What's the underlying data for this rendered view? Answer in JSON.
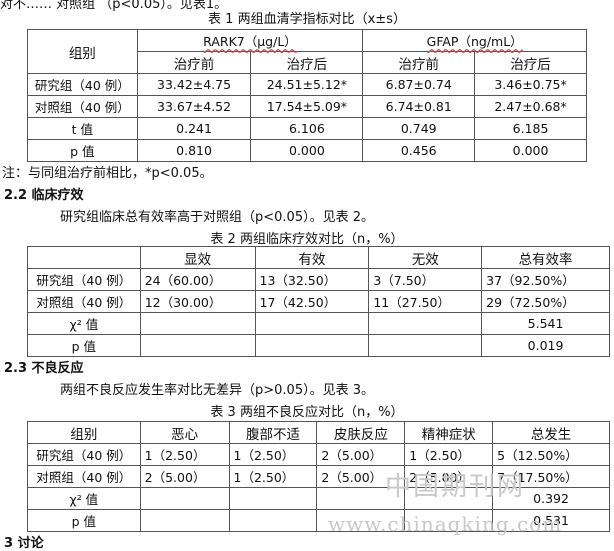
{
  "top_fragment": "对不…… 对照组 （p<0.05）。见表1。",
  "table1": {
    "caption": "表 1 两组血清学指标对比（x±s）",
    "group_header": "组别",
    "col_rark7": "RARK7（μg/L）",
    "col_gfap": "GFAP（ng/mL）",
    "sub_before": "治疗前",
    "sub_after": "治疗后",
    "rows": [
      {
        "label": "研究组（40 例）",
        "a": "33.42±4.75",
        "b": "24.51±5.12*",
        "c": "6.87±0.74",
        "d": "3.46±0.75*"
      },
      {
        "label": "对照组（40 例）",
        "a": "33.67±4.52",
        "b": "17.54±5.09*",
        "c": "6.74±0.81",
        "d": "2.47±0.68*"
      },
      {
        "label": "t 值",
        "a": "0.241",
        "b": "6.106",
        "c": "0.749",
        "d": "6.185"
      },
      {
        "label": "p 值",
        "a": "0.810",
        "b": "0.000",
        "c": "0.456",
        "d": "0.000"
      }
    ],
    "note": "注：与同组治疗前相比，*p<0.05。"
  },
  "section22": {
    "heading": "2.2 临床疗效",
    "body": "研究组临床总有效率高于对照组（p<0.05）。见表 2。"
  },
  "table2": {
    "caption": "表 2 两组临床疗效对比（n，%）",
    "headers": [
      "",
      "显效",
      "有效",
      "无效",
      "总有效率"
    ],
    "rows": [
      {
        "label": "研究组（40 例）",
        "c1": "24（60.00）",
        "c2": "13（32.50）",
        "c3": "3（7.50）",
        "c4": "37（92.50%）"
      },
      {
        "label": "对照组（40 例）",
        "c1": "12（30.00）",
        "c2": "17（42.50）",
        "c3": "11（27.50）",
        "c4": "29（72.50%）"
      },
      {
        "label": "χ² 值",
        "c1": "",
        "c2": "",
        "c3": "",
        "c4": "5.541"
      },
      {
        "label": "p 值",
        "c1": "",
        "c2": "",
        "c3": "",
        "c4": "0.019"
      }
    ]
  },
  "section23": {
    "heading": "2.3 不良反应",
    "body": "两组不良反应发生率对比无差异（p>0.05）。见表 3。"
  },
  "table3": {
    "caption": "表 3 两组不良反应对比（n，%）",
    "headers": [
      "组别",
      "恶心",
      "腹部不适",
      "皮肤反应",
      "精神症状",
      "总发生"
    ],
    "rows": [
      {
        "label": "研究组（40 例）",
        "c1": "1（2.50）",
        "c2": "1（2.50）",
        "c3": "2（5.00）",
        "c4": "1（2.50）",
        "c5": "5（12.50%）"
      },
      {
        "label": "对照组（40 例）",
        "c1": "2（5.00）",
        "c2": "1（2.50）",
        "c3": "2（5.00）",
        "c4": "2（5.00）",
        "c5": "7（17.50%）"
      },
      {
        "label": "χ² 值",
        "c1": "",
        "c2": "",
        "c3": "",
        "c4": "",
        "c5": "0.392"
      },
      {
        "label": "p 值",
        "c1": "",
        "c2": "",
        "c3": "",
        "c4": "",
        "c5": "0.531"
      }
    ]
  },
  "watermark": {
    "cn": "中国期刊网",
    "url": "www.chinaqking.com"
  },
  "bottom_fragment": "3 讨论"
}
